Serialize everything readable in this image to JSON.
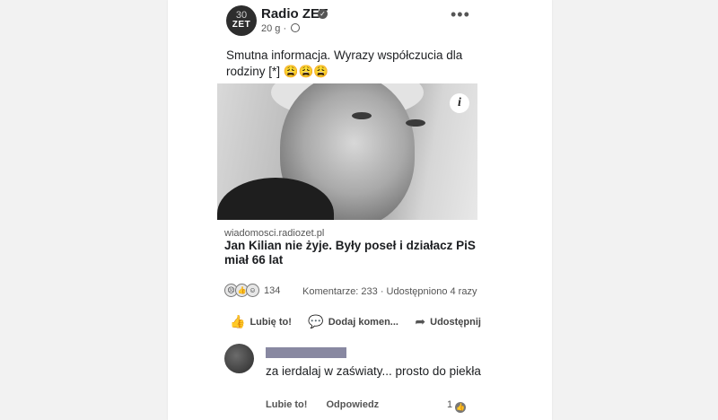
{
  "post": {
    "page_name": "Radio ZET",
    "avatar_top": "30",
    "avatar_bottom": "ZET",
    "meta": "20 g ·",
    "text": "Smutna informacja. Wyrazy współczucia dla rodziny [*] 😩😩😩",
    "more": "•••",
    "link_domain": "wiadomosci.radiozet.pl",
    "link_title": "Jan Kilian nie żyje. Były poseł i działacz PiS miał 66 lat",
    "info_glyph": "i",
    "reaction_count": "134",
    "stats": "Komentarze: 233 · Udostępniono 4 razy"
  },
  "actions": {
    "like": "Lubię to!",
    "comment": "Dodaj komen...",
    "share": "Udostępnij"
  },
  "comment": {
    "text": "za ierdalaj w zaświaty... prosto do piekła",
    "like": "Lubie to!",
    "reply": "Odpowiedz",
    "likes_count": "1"
  },
  "icons": {
    "verified": "verified-badge-icon",
    "globe": "globe-icon",
    "more": "more-options-icon",
    "info": "info-icon",
    "like": "thumbs-up-icon",
    "comment": "speech-bubble-icon",
    "share": "share-arrow-icon"
  }
}
